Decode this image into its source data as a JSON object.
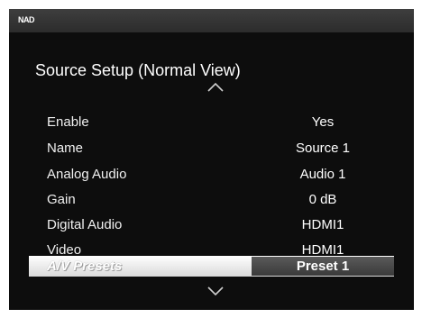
{
  "header": {
    "brand": "NAD"
  },
  "menu": {
    "title": "Source Setup (Normal View)",
    "scroll_up_icon": "chevron-up-icon",
    "scroll_down_icon": "chevron-down-icon",
    "rows": [
      {
        "label": "Enable",
        "value": "Yes",
        "selected": false
      },
      {
        "label": "Name",
        "value": "Source 1",
        "selected": false
      },
      {
        "label": "Analog Audio",
        "value": "Audio 1",
        "selected": false
      },
      {
        "label": "Gain",
        "value": "0 dB",
        "selected": false
      },
      {
        "label": "Digital Audio",
        "value": "HDMI1",
        "selected": false
      },
      {
        "label": "Video",
        "value": "HDMI1",
        "selected": false
      },
      {
        "label": "A/V Presets",
        "value": "Preset 1",
        "selected": true
      }
    ]
  },
  "colors": {
    "background": "#0d0d0d",
    "text": "#ffffff",
    "highlight": "#ffffff",
    "value_box": "#4a4a4a"
  }
}
